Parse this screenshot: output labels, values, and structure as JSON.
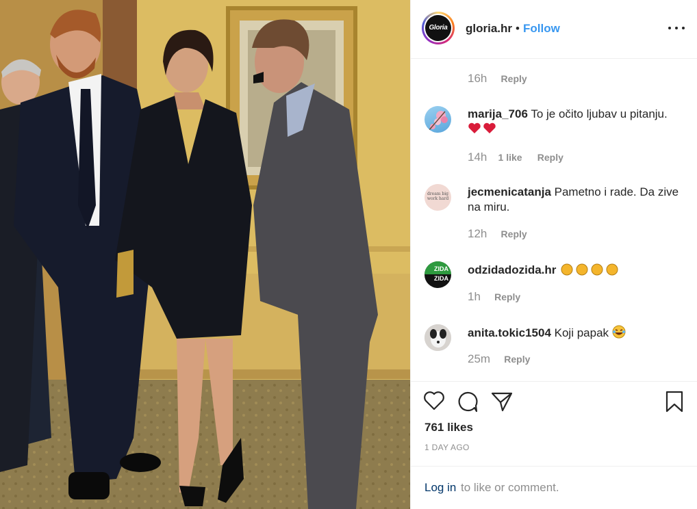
{
  "post": {
    "account": "gloria.hr",
    "avatar_text": "Gloria",
    "separator": "•",
    "follow_label": "Follow",
    "more_icon": "more-horizontal-icon"
  },
  "comments": [
    {
      "username": "",
      "text": "",
      "time": "16h",
      "likes": "",
      "reply_label": "Reply"
    },
    {
      "username": "marija_706",
      "text": "To je očito ljubav u pitanju.",
      "emoji": "❤❤",
      "time": "14h",
      "likes": "1 like",
      "reply_label": "Reply"
    },
    {
      "username": "jecmenicatanja",
      "text": "Pametno i rade. Da zive na miru.",
      "avatar_text": "dream big work hard",
      "time": "12h",
      "likes": "",
      "reply_label": "Reply"
    },
    {
      "username": "odzidadozida.hr",
      "text": "",
      "emoji": "👏👏👏👏",
      "avatar_text": "ZIDA ZIDA",
      "time": "1h",
      "likes": "",
      "reply_label": "Reply"
    },
    {
      "username": "anita.tokic1504",
      "text": "Koji papak",
      "emoji": "😂",
      "time": "25m",
      "likes": "",
      "reply_label": "Reply"
    }
  ],
  "actions": {
    "like_icon": "heart-icon",
    "comment_icon": "comment-icon",
    "share_icon": "share-icon",
    "save_icon": "bookmark-icon",
    "likes_count": "761 likes",
    "posted": "1 DAY AGO"
  },
  "login": {
    "link_label": "Log in",
    "rest_text": "to like or comment."
  },
  "colors": {
    "link_blue": "#3897f0",
    "login_link": "#003569",
    "muted": "#8e8e8e",
    "text": "#262626",
    "border": "#efefef"
  }
}
